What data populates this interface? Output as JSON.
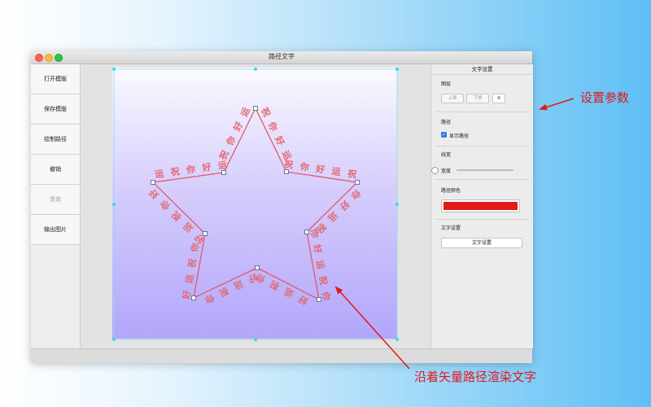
{
  "window": {
    "title": "路径文字"
  },
  "left_panel": {
    "buttons": [
      "打开模版",
      "保存模版",
      "绘制路径",
      "撤销",
      "重做",
      "输出图片"
    ]
  },
  "right_panel": {
    "title": "文字设置",
    "layer_section": {
      "label": "图层",
      "up_label": "上移",
      "down_label": "下移",
      "delete_label": "X"
    },
    "path_section": {
      "label": "路径",
      "show_path_label": "显示路径",
      "show_path_checked": true
    },
    "line_width_section": {
      "label": "线宽",
      "width_label": "宽度",
      "value_fraction": 0.05
    },
    "path_color_section": {
      "label": "路径颜色",
      "color": "#e01b1b"
    },
    "text_settings_section": {
      "label": "文字设置",
      "button_label": "文字设置"
    }
  },
  "path_text": {
    "phrase": "祝你好运",
    "text_color": "#e46670",
    "path_color": "#e05a68",
    "handle_color": "#2fdcf2"
  },
  "annotations": {
    "top_right": "设置参数",
    "bottom": "沿着矢量路径渲染文字",
    "color": "#e5161c"
  }
}
